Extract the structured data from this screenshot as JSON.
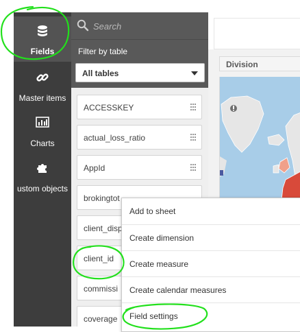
{
  "rail": {
    "items": [
      {
        "label": "Fields",
        "icon": "database-icon",
        "active": true
      },
      {
        "label": "Master items",
        "icon": "link-icon",
        "active": false
      },
      {
        "label": "Charts",
        "icon": "bar-chart-icon",
        "active": false
      },
      {
        "label": "ustom objects",
        "icon": "puzzle-icon",
        "active": false
      }
    ]
  },
  "panel": {
    "search_placeholder": "Search",
    "filter_label": "Filter by table",
    "table_select": "All tables",
    "fields": [
      "ACCESSKEY",
      "actual_loss_ratio",
      "AppId",
      "brokingtot",
      "client_disp",
      "client_id",
      "commissi",
      "coverage"
    ]
  },
  "sheet": {
    "column_header": "Division"
  },
  "context_menu": {
    "items": [
      "Add to sheet",
      "Create dimension",
      "Create measure",
      "Create calendar measures",
      "Field settings"
    ]
  },
  "colors": {
    "rail_bg": "#3d3d3d",
    "rail_active": "#535353",
    "panel_bg": "#595959",
    "list_bg": "#efefef",
    "annotation": "#22e01c"
  }
}
